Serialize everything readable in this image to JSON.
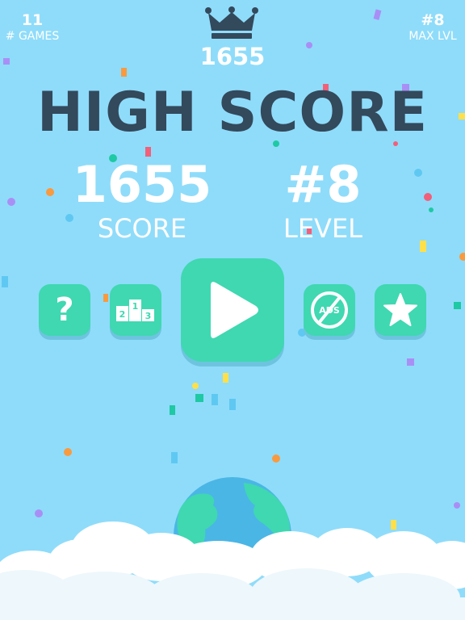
{
  "stats": {
    "games_count": "11",
    "games_label": "# GAMES",
    "max_level": "#8",
    "max_level_label": "MAX LVL"
  },
  "best": {
    "score": "1655"
  },
  "title": "HIGH SCORE",
  "result": {
    "score": "1655",
    "score_label": "SCORE",
    "level": "#8",
    "level_label": "LEVEL"
  },
  "buttons": {
    "help_label": "?",
    "leaderboard_places": [
      "2",
      "1",
      "3"
    ],
    "noads_label": "ADS",
    "help_icon": "question-mark-icon",
    "leaderboard_icon": "podium-icon",
    "play_icon": "play-icon",
    "noads_icon": "no-ads-icon",
    "rate_icon": "star-icon"
  },
  "colors": {
    "background": "#8fdcfa",
    "button": "#3fd8b1",
    "title": "#33495c",
    "text": "#ffffff"
  }
}
